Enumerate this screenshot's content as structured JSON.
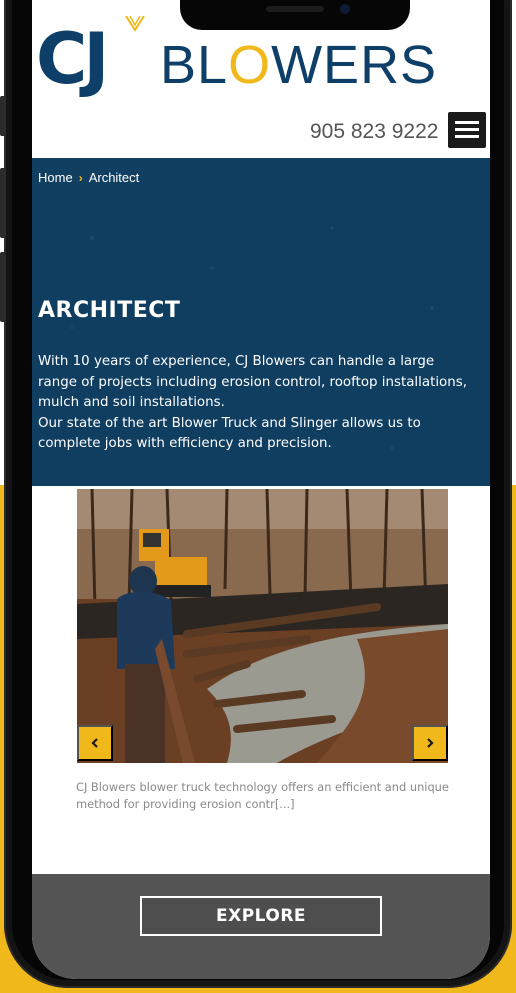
{
  "brand": {
    "logo_mark_text": "CJ",
    "logo_word_prefix": "BL",
    "logo_word_accent": "O",
    "logo_word_suffix": "WERS",
    "primary_color": "#0e3f69",
    "accent_color": "#f1b81c"
  },
  "header": {
    "phone": "905 823 9222",
    "menu_icon": "hamburger-icon"
  },
  "breadcrumb": {
    "home": "Home",
    "separator": "›",
    "current": "Architect"
  },
  "hero": {
    "title": "ARCHITECT",
    "paragraph_1": "With 10 years of experience, CJ Blowers can handle a large range of projects including erosion control, rooftop installations, mulch and soil installations.",
    "paragraph_2": "Our state of the art Blower Truck and Slinger allows us to complete jobs with efficiency and precision."
  },
  "carousel": {
    "image_subject": "excavator-and-worker-at-erosion-control-site",
    "prev_icon": "chevron-left-icon",
    "next_icon": "chevron-right-icon",
    "caption": "CJ Blowers blower truck technology offers an efficient and unique method for providing erosion contr[...]"
  },
  "cta": {
    "explore_label": "EXPLORE"
  }
}
